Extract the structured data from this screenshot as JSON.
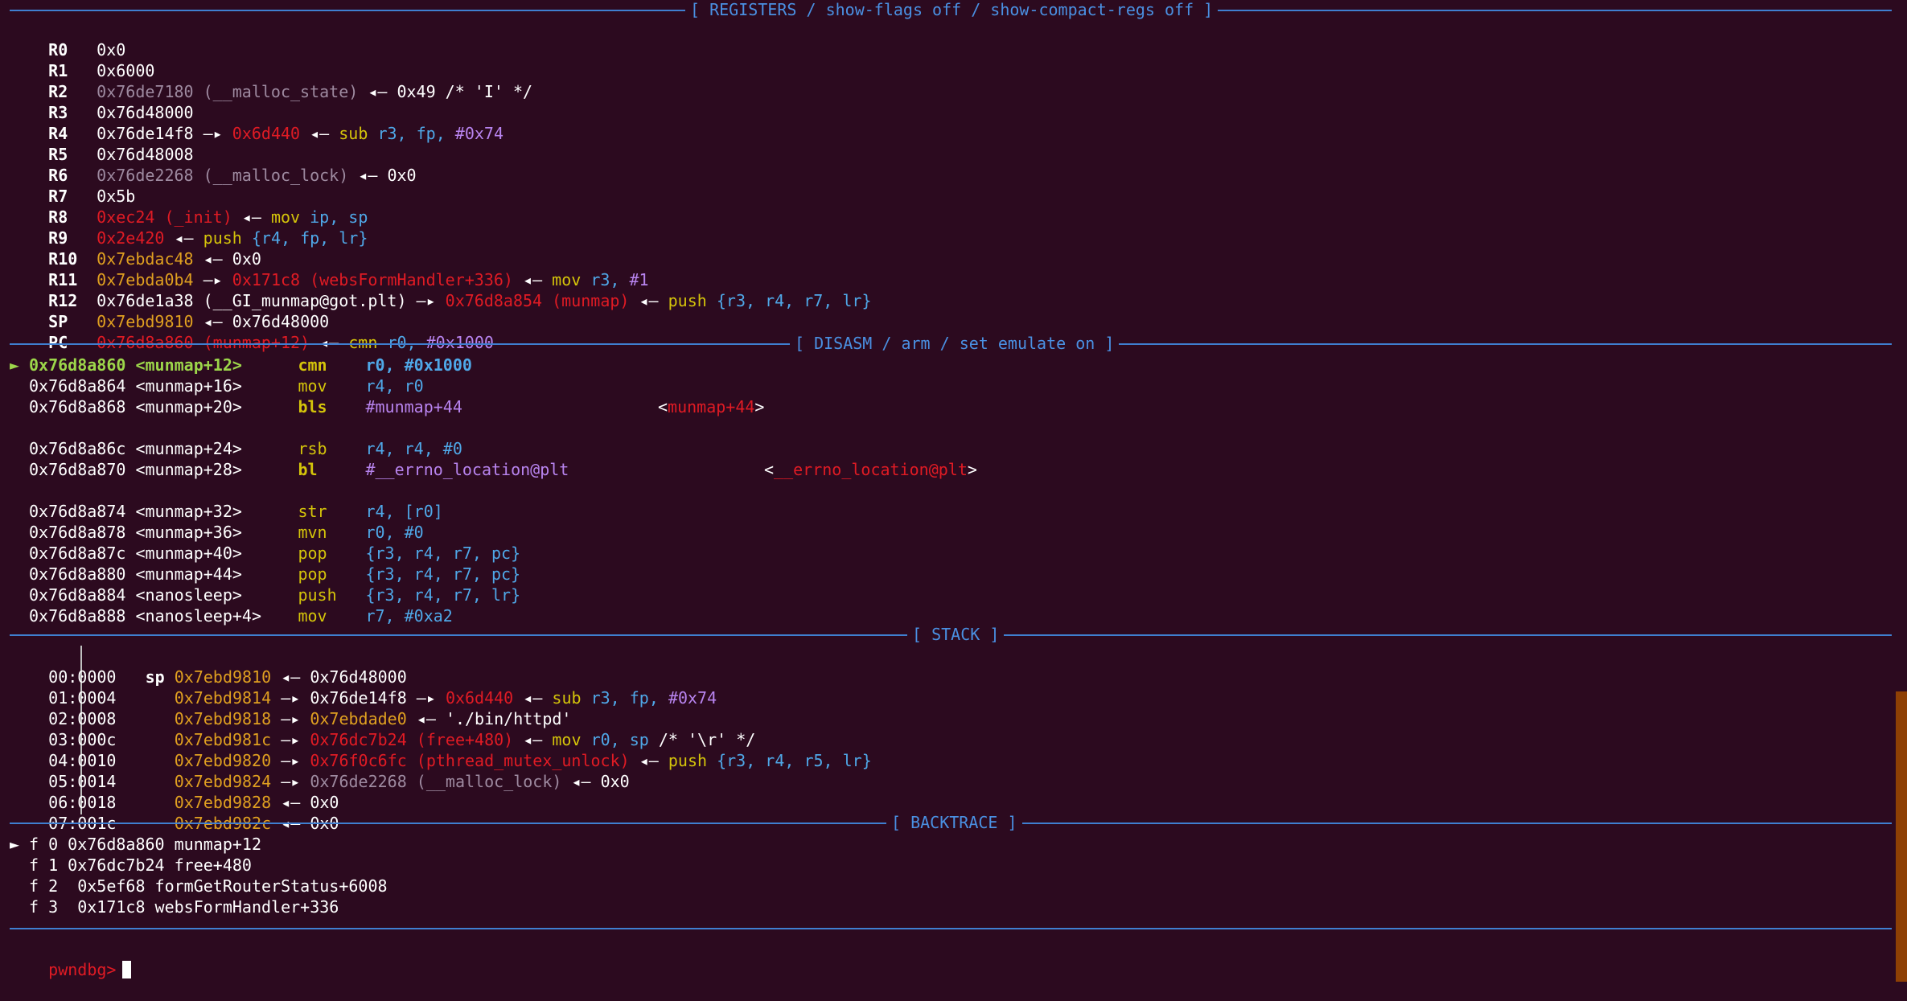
{
  "headers": {
    "registers": "[ REGISTERS / show-flags off / show-compact-regs off ]",
    "disasm": "[ DISASM / arm / set emulate on ]",
    "stack": "[ STACK ]",
    "backtrace": "[ BACKTRACE ]"
  },
  "arrows": {
    "right": "—▸",
    "left": "◂—"
  },
  "registers": {
    "r0": {
      "name": "R0",
      "val": "0x0"
    },
    "r1": {
      "name": "R1",
      "val": "0x6000"
    },
    "r2": {
      "name": "R2",
      "val": "0x76de7180 (__malloc_state)",
      "tail": "0x49 /* 'I' */"
    },
    "r3": {
      "name": "R3",
      "val": "0x76d48000"
    },
    "r4": {
      "name": "R4",
      "val": "0x76de14f8",
      "ptr": "0x6d440",
      "ins": "sub",
      "ops": [
        "r3,",
        "fp,",
        "#0x74"
      ]
    },
    "r5": {
      "name": "R5",
      "val": "0x76d48008"
    },
    "r6": {
      "name": "R6",
      "val": "0x76de2268 (__malloc_lock)",
      "tail": "0x0"
    },
    "r7": {
      "name": "R7",
      "val": "0x5b"
    },
    "r8": {
      "name": "R8",
      "val": "0xec24 (_init)",
      "ins": "mov",
      "ops": [
        "ip,",
        "sp"
      ]
    },
    "r9": {
      "name": "R9",
      "val": "0x2e420",
      "ins": "push",
      "ops": [
        "{r4, fp, lr}"
      ]
    },
    "r10": {
      "name": "R10",
      "val": "0x7ebdac48",
      "tail": "0x0"
    },
    "r11": {
      "name": "R11",
      "val": "0x7ebda0b4",
      "ptr": "0x171c8 (websFormHandler+336)",
      "ins": "mov",
      "ops": [
        "r3,",
        "#1"
      ]
    },
    "r12": {
      "name": "R12",
      "val": "0x76de1a38 (__GI_munmap@got.plt)",
      "ptr": "0x76d8a854 (munmap)",
      "ins": "push",
      "ops": [
        "{r3, r4, r7, lr}"
      ]
    },
    "sp": {
      "name": "SP",
      "val": "0x7ebd9810",
      "tail": "0x76d48000"
    },
    "pc": {
      "name": "PC",
      "val": "0x76d8a860 (munmap+12)",
      "ins": "cmn",
      "ops": [
        "r0,",
        "#0x1000"
      ]
    }
  },
  "disasm": {
    "cur_marker": "►",
    "lines": [
      {
        "addr": "0x76d8a860",
        "sym": "<munmap+12>",
        "mn": "cmn",
        "ops": "r0, #0x1000"
      },
      {
        "addr": "0x76d8a864",
        "sym": "<munmap+16>",
        "mn": "mov",
        "ops": "r4, r0"
      },
      {
        "addr": "0x76d8a868",
        "sym": "<munmap+20>",
        "mn": "bls",
        "ops": "#munmap+44",
        "target_pre": "<",
        "target": "munmap+44",
        "target_post": ">"
      },
      {
        "addr": "0x76d8a86c",
        "sym": "<munmap+24>",
        "mn": "rsb",
        "ops": "r4, r4, #0"
      },
      {
        "addr": "0x76d8a870",
        "sym": "<munmap+28>",
        "mn": "bl",
        "ops": "#__errno_location@plt",
        "target_pre": "<",
        "target": "__errno_location@plt",
        "target_post": ">"
      },
      {
        "addr": "0x76d8a874",
        "sym": "<munmap+32>",
        "mn": "str",
        "ops": "r4, [r0]"
      },
      {
        "addr": "0x76d8a878",
        "sym": "<munmap+36>",
        "mn": "mvn",
        "ops": "r0, #0"
      },
      {
        "addr": "0x76d8a87c",
        "sym": "<munmap+40>",
        "mn": "pop",
        "ops": "{r3, r4, r7, pc}"
      },
      {
        "addr": "0x76d8a880",
        "sym": "<munmap+44>",
        "mn": "pop",
        "ops": "{r3, r4, r7, pc}"
      },
      {
        "addr": "0x76d8a884",
        "sym": "<nanosleep>",
        "mn": "push",
        "ops": "{r3, r4, r7, lr}"
      },
      {
        "addr": "0x76d8a888",
        "sym": "<nanosleep+4>",
        "mn": "mov",
        "ops": "r7, #0xa2"
      }
    ]
  },
  "stack": {
    "s0": {
      "idx": "00:0000",
      "sp": "sp",
      "addr": "0x7ebd9810",
      "tail": "0x76d48000"
    },
    "s1": {
      "idx": "01:0004",
      "addr": "0x7ebd9814",
      "v1": "0x76de14f8",
      "v2": "0x6d440",
      "ins": "sub",
      "ops": [
        "r3,",
        "fp,",
        "#0x74"
      ]
    },
    "s2": {
      "idx": "02:0008",
      "addr": "0x7ebd9818",
      "v1": "0x7ebdade0",
      "str": "'./bin/httpd'"
    },
    "s3": {
      "idx": "03:000c",
      "addr": "0x7ebd981c",
      "v1": "0x76dc7b24 (free+480)",
      "ins": "mov",
      "ops": [
        "r0,",
        "sp"
      ],
      "cmt": "/* '\\r' */"
    },
    "s4": {
      "idx": "04:0010",
      "addr": "0x7ebd9820",
      "v1": "0x76f0c6fc (pthread_mutex_unlock)",
      "ins": "push",
      "ops": [
        "{r3, r4, r5, lr}"
      ]
    },
    "s5": {
      "idx": "05:0014",
      "addr": "0x7ebd9824",
      "v1": "0x76de2268 (__malloc_lock)",
      "tail": "0x0"
    },
    "s6": {
      "idx": "06:0018",
      "addr": "0x7ebd9828",
      "tail": "0x0"
    },
    "s7": {
      "idx": "07:001c",
      "addr": "0x7ebd982c",
      "tail": "0x0"
    }
  },
  "backtrace": [
    {
      "marker": "►",
      "frame": "f 0",
      "text": "0x76d8a860 munmap+12"
    },
    {
      "marker": "",
      "frame": "f 1",
      "text": "0x76dc7b24 free+480"
    },
    {
      "marker": "",
      "frame": "f 2",
      "text": " 0x5ef68 formGetRouterStatus+6008"
    },
    {
      "marker": "",
      "frame": "f 3",
      "text": " 0x171c8 websFormHandler+336"
    }
  ],
  "prompt": "pwndbg>"
}
